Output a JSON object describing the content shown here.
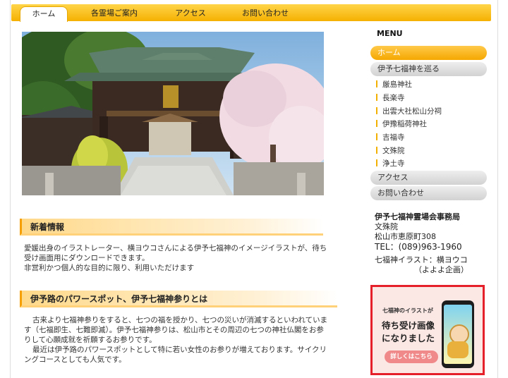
{
  "nav": {
    "tabs": [
      "ホーム",
      "各霊場ご案内",
      "アクセス",
      "お問い合わせ"
    ]
  },
  "news": {
    "title": "新着情報",
    "lines": [
      "愛媛出身のイラストレーター、横ヨウコさんによる伊予七福神のイメージイラストが、待ち",
      "受け画面用にダウンロードできます。",
      "非営利かつ個人的な目的に限り、利用いただけます"
    ]
  },
  "about": {
    "title": "伊予路のパワースポット、伊予七福神参りとは",
    "lines": [
      "古来より七福神参りをすると、七つの福を授かり、七つの災いが消滅するといわれていま",
      "す（七福即生、七難即滅）。伊予七福神参りは、松山市とその周辺の七つの神社仏閣をお参",
      "りして心願成就を祈願するお参りです。",
      "最近は伊予路のパワースポットとして特に若い女性のお参りが増えております。サイクリ",
      "ングコースとしても人気です。"
    ]
  },
  "sidebar": {
    "menu_title": "MENU",
    "home": "ホーム",
    "tour": "伊予七福神を巡る",
    "temples": [
      "厳島神社",
      "長楽寺",
      "出雲大社松山分祠",
      "伊豫稲荷神社",
      "吉福寺",
      "文殊院",
      "浄土寺"
    ],
    "access": "アクセス",
    "contact": "お問い合わせ"
  },
  "office": {
    "name": "伊予七福神霊場会事務局",
    "place": "文殊院",
    "address": "松山市恵原町308",
    "tel": "TEL：(089)963-1960",
    "credit1": "七福神イラスト：横ヨウコ",
    "credit2": "（よよよ企画）"
  },
  "banner": {
    "line1": "七福神のイラストが",
    "line2": "待ち受け画像",
    "line3": "になりました",
    "button": "詳しくはこちら"
  }
}
